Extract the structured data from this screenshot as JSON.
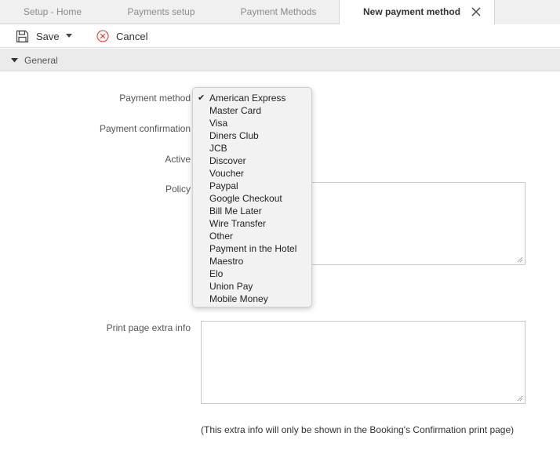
{
  "tabs": [
    {
      "label": "Setup - Home"
    },
    {
      "label": "Payments setup"
    },
    {
      "label": "Payment Methods"
    },
    {
      "label": "New payment method"
    }
  ],
  "toolbar": {
    "save_label": "Save",
    "cancel_label": "Cancel",
    "icons": [
      "floppy-disk-icon",
      "caret-down-icon",
      "cancel-circle-icon"
    ],
    "cancel_color": "#e03b3b"
  },
  "section": {
    "title": "General"
  },
  "form": {
    "payment_method_label": "Payment method",
    "payment_confirmation_label": "Payment confirmation",
    "active_label": "Active",
    "policy_label": "Policy",
    "policy_value": "",
    "print_extra_label": "Print page extra info",
    "print_extra_value": "",
    "note": "(This extra info will only be shown in the Booking's Confirmation print page)"
  },
  "dropdown": {
    "selected": "American Express",
    "options": [
      "American Express",
      "Master Card",
      "Visa",
      "Diners Club",
      "JCB",
      "Discover",
      "Voucher",
      "Paypal",
      "Google Checkout",
      "Bill Me Later",
      "Wire Transfer",
      "Other",
      "Payment in the Hotel",
      "Maestro",
      "Elo",
      "Union Pay",
      "Mobile Money"
    ]
  }
}
